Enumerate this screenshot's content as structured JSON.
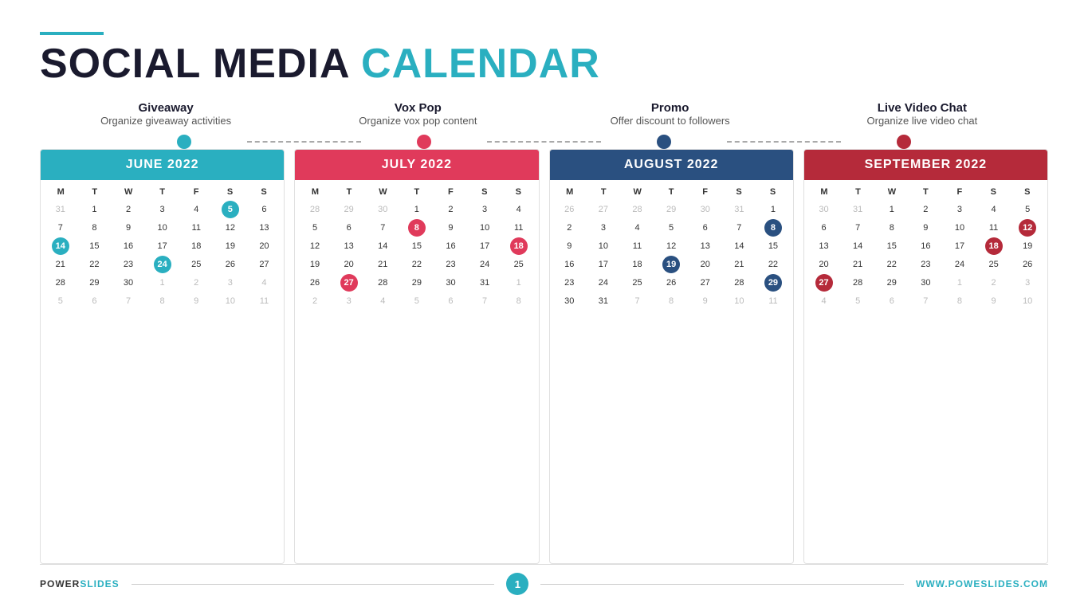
{
  "title": {
    "line1_dark": "SOCIAL MEDIA",
    "line1_accent": "CALENDAR"
  },
  "categories": [
    {
      "id": "giveaway",
      "title": "Giveaway",
      "desc": "Organize giveaway activities",
      "dot_color": "dot-blue"
    },
    {
      "id": "vox-pop",
      "title": "Vox Pop",
      "desc": "Organize vox pop content",
      "dot_color": "dot-red"
    },
    {
      "id": "promo",
      "title": "Promo",
      "desc": "Offer discount to followers",
      "dot_color": "dot-darkblue"
    },
    {
      "id": "live-video",
      "title": "Live Video Chat",
      "desc": "Organize live video chat",
      "dot_color": "dot-darkred"
    }
  ],
  "calendars": [
    {
      "id": "june",
      "month": "JUNE 2022",
      "header_class": "blue-header",
      "weekdays": [
        "M",
        "T",
        "W",
        "T",
        "F",
        "S",
        "S"
      ],
      "weeks": [
        [
          {
            "d": "31",
            "c": "other-month"
          },
          {
            "d": "1",
            "c": ""
          },
          {
            "d": "2",
            "c": ""
          },
          {
            "d": "3",
            "c": ""
          },
          {
            "d": "4",
            "c": ""
          },
          {
            "d": "5",
            "c": "highlight-blue"
          },
          {
            "d": "6",
            "c": ""
          }
        ],
        [
          {
            "d": "7",
            "c": ""
          },
          {
            "d": "8",
            "c": ""
          },
          {
            "d": "9",
            "c": ""
          },
          {
            "d": "10",
            "c": ""
          },
          {
            "d": "11",
            "c": ""
          },
          {
            "d": "12",
            "c": ""
          },
          {
            "d": "13",
            "c": ""
          }
        ],
        [
          {
            "d": "14",
            "c": "highlight-blue"
          },
          {
            "d": "15",
            "c": ""
          },
          {
            "d": "16",
            "c": ""
          },
          {
            "d": "17",
            "c": ""
          },
          {
            "d": "18",
            "c": ""
          },
          {
            "d": "19",
            "c": ""
          },
          {
            "d": "20",
            "c": ""
          }
        ],
        [
          {
            "d": "21",
            "c": ""
          },
          {
            "d": "22",
            "c": ""
          },
          {
            "d": "23",
            "c": ""
          },
          {
            "d": "24",
            "c": "highlight-blue"
          },
          {
            "d": "25",
            "c": ""
          },
          {
            "d": "26",
            "c": ""
          },
          {
            "d": "27",
            "c": ""
          }
        ],
        [
          {
            "d": "28",
            "c": ""
          },
          {
            "d": "29",
            "c": ""
          },
          {
            "d": "30",
            "c": ""
          },
          {
            "d": "1",
            "c": "other-month"
          },
          {
            "d": "2",
            "c": "other-month"
          },
          {
            "d": "3",
            "c": "other-month"
          },
          {
            "d": "4",
            "c": "other-month"
          }
        ],
        [
          {
            "d": "5",
            "c": "other-month"
          },
          {
            "d": "6",
            "c": "other-month"
          },
          {
            "d": "7",
            "c": "other-month"
          },
          {
            "d": "8",
            "c": "other-month"
          },
          {
            "d": "9",
            "c": "other-month"
          },
          {
            "d": "10",
            "c": "other-month"
          },
          {
            "d": "11",
            "c": "other-month"
          }
        ]
      ]
    },
    {
      "id": "july",
      "month": "JULY 2022",
      "header_class": "red-header",
      "weekdays": [
        "M",
        "T",
        "W",
        "T",
        "F",
        "S",
        "S"
      ],
      "weeks": [
        [
          {
            "d": "28",
            "c": "other-month"
          },
          {
            "d": "29",
            "c": "other-month"
          },
          {
            "d": "30",
            "c": "other-month"
          },
          {
            "d": "1",
            "c": ""
          },
          {
            "d": "2",
            "c": ""
          },
          {
            "d": "3",
            "c": ""
          },
          {
            "d": "4",
            "c": ""
          }
        ],
        [
          {
            "d": "5",
            "c": ""
          },
          {
            "d": "6",
            "c": ""
          },
          {
            "d": "7",
            "c": ""
          },
          {
            "d": "8",
            "c": "highlight-red"
          },
          {
            "d": "9",
            "c": ""
          },
          {
            "d": "10",
            "c": ""
          },
          {
            "d": "11",
            "c": ""
          }
        ],
        [
          {
            "d": "12",
            "c": ""
          },
          {
            "d": "13",
            "c": ""
          },
          {
            "d": "14",
            "c": ""
          },
          {
            "d": "15",
            "c": ""
          },
          {
            "d": "16",
            "c": ""
          },
          {
            "d": "17",
            "c": ""
          },
          {
            "d": "18",
            "c": "highlight-red"
          }
        ],
        [
          {
            "d": "19",
            "c": ""
          },
          {
            "d": "20",
            "c": ""
          },
          {
            "d": "21",
            "c": ""
          },
          {
            "d": "22",
            "c": ""
          },
          {
            "d": "23",
            "c": ""
          },
          {
            "d": "24",
            "c": ""
          },
          {
            "d": "25",
            "c": ""
          }
        ],
        [
          {
            "d": "26",
            "c": ""
          },
          {
            "d": "27",
            "c": "highlight-red"
          },
          {
            "d": "28",
            "c": ""
          },
          {
            "d": "29",
            "c": ""
          },
          {
            "d": "30",
            "c": ""
          },
          {
            "d": "31",
            "c": ""
          },
          {
            "d": "1",
            "c": "other-month"
          }
        ],
        [
          {
            "d": "2",
            "c": "other-month"
          },
          {
            "d": "3",
            "c": "other-month"
          },
          {
            "d": "4",
            "c": "other-month"
          },
          {
            "d": "5",
            "c": "other-month"
          },
          {
            "d": "6",
            "c": "other-month"
          },
          {
            "d": "7",
            "c": "other-month"
          },
          {
            "d": "8",
            "c": "other-month"
          }
        ]
      ]
    },
    {
      "id": "august",
      "month": "AUGUST 2022",
      "header_class": "darkblue-header",
      "weekdays": [
        "M",
        "T",
        "W",
        "T",
        "F",
        "S",
        "S"
      ],
      "weeks": [
        [
          {
            "d": "26",
            "c": "other-month"
          },
          {
            "d": "27",
            "c": "other-month"
          },
          {
            "d": "28",
            "c": "other-month"
          },
          {
            "d": "29",
            "c": "other-month"
          },
          {
            "d": "30",
            "c": "other-month"
          },
          {
            "d": "31",
            "c": "other-month"
          },
          {
            "d": "1",
            "c": ""
          }
        ],
        [
          {
            "d": "2",
            "c": ""
          },
          {
            "d": "3",
            "c": ""
          },
          {
            "d": "4",
            "c": ""
          },
          {
            "d": "5",
            "c": ""
          },
          {
            "d": "6",
            "c": ""
          },
          {
            "d": "7",
            "c": ""
          },
          {
            "d": "8",
            "c": "highlight-darkblue"
          }
        ],
        [
          {
            "d": "9",
            "c": ""
          },
          {
            "d": "10",
            "c": ""
          },
          {
            "d": "11",
            "c": ""
          },
          {
            "d": "12",
            "c": ""
          },
          {
            "d": "13",
            "c": ""
          },
          {
            "d": "14",
            "c": ""
          },
          {
            "d": "15",
            "c": ""
          }
        ],
        [
          {
            "d": "16",
            "c": ""
          },
          {
            "d": "17",
            "c": ""
          },
          {
            "d": "18",
            "c": ""
          },
          {
            "d": "19",
            "c": "highlight-darkblue"
          },
          {
            "d": "20",
            "c": ""
          },
          {
            "d": "21",
            "c": ""
          },
          {
            "d": "22",
            "c": ""
          }
        ],
        [
          {
            "d": "23",
            "c": ""
          },
          {
            "d": "24",
            "c": ""
          },
          {
            "d": "25",
            "c": ""
          },
          {
            "d": "26",
            "c": ""
          },
          {
            "d": "27",
            "c": ""
          },
          {
            "d": "28",
            "c": ""
          },
          {
            "d": "29",
            "c": "highlight-darkblue"
          }
        ],
        [
          {
            "d": "30",
            "c": ""
          },
          {
            "d": "31",
            "c": ""
          },
          {
            "d": "7",
            "c": "other-month"
          },
          {
            "d": "8",
            "c": "other-month"
          },
          {
            "d": "9",
            "c": "other-month"
          },
          {
            "d": "10",
            "c": "other-month"
          },
          {
            "d": "11",
            "c": "other-month"
          }
        ]
      ]
    },
    {
      "id": "september",
      "month": "SEPTEMBER 2022",
      "header_class": "darkred-header",
      "weekdays": [
        "M",
        "T",
        "W",
        "T",
        "F",
        "S",
        "S"
      ],
      "weeks": [
        [
          {
            "d": "30",
            "c": "other-month"
          },
          {
            "d": "31",
            "c": "other-month"
          },
          {
            "d": "1",
            "c": ""
          },
          {
            "d": "2",
            "c": ""
          },
          {
            "d": "3",
            "c": ""
          },
          {
            "d": "4",
            "c": ""
          },
          {
            "d": "5",
            "c": ""
          }
        ],
        [
          {
            "d": "6",
            "c": ""
          },
          {
            "d": "7",
            "c": ""
          },
          {
            "d": "8",
            "c": ""
          },
          {
            "d": "9",
            "c": ""
          },
          {
            "d": "10",
            "c": ""
          },
          {
            "d": "11",
            "c": ""
          },
          {
            "d": "12",
            "c": "highlight-darkred"
          }
        ],
        [
          {
            "d": "13",
            "c": ""
          },
          {
            "d": "14",
            "c": ""
          },
          {
            "d": "15",
            "c": ""
          },
          {
            "d": "16",
            "c": ""
          },
          {
            "d": "17",
            "c": ""
          },
          {
            "d": "18",
            "c": "highlight-darkred"
          },
          {
            "d": "19",
            "c": ""
          }
        ],
        [
          {
            "d": "20",
            "c": ""
          },
          {
            "d": "21",
            "c": ""
          },
          {
            "d": "22",
            "c": ""
          },
          {
            "d": "23",
            "c": ""
          },
          {
            "d": "24",
            "c": ""
          },
          {
            "d": "25",
            "c": ""
          },
          {
            "d": "26",
            "c": ""
          }
        ],
        [
          {
            "d": "27",
            "c": "highlight-darkred"
          },
          {
            "d": "28",
            "c": ""
          },
          {
            "d": "29",
            "c": ""
          },
          {
            "d": "30",
            "c": ""
          },
          {
            "d": "1",
            "c": "other-month"
          },
          {
            "d": "2",
            "c": "other-month"
          },
          {
            "d": "3",
            "c": "other-month"
          }
        ],
        [
          {
            "d": "4",
            "c": "other-month"
          },
          {
            "d": "5",
            "c": "other-month"
          },
          {
            "d": "6",
            "c": "other-month"
          },
          {
            "d": "7",
            "c": "other-month"
          },
          {
            "d": "8",
            "c": "other-month"
          },
          {
            "d": "9",
            "c": "other-month"
          },
          {
            "d": "10",
            "c": "other-month"
          }
        ]
      ]
    }
  ],
  "footer": {
    "left_brand": "POWER",
    "left_brand_accent": "SLIDES",
    "page_num": "1",
    "right_url": "WWW.POWESLIDES.COM"
  }
}
